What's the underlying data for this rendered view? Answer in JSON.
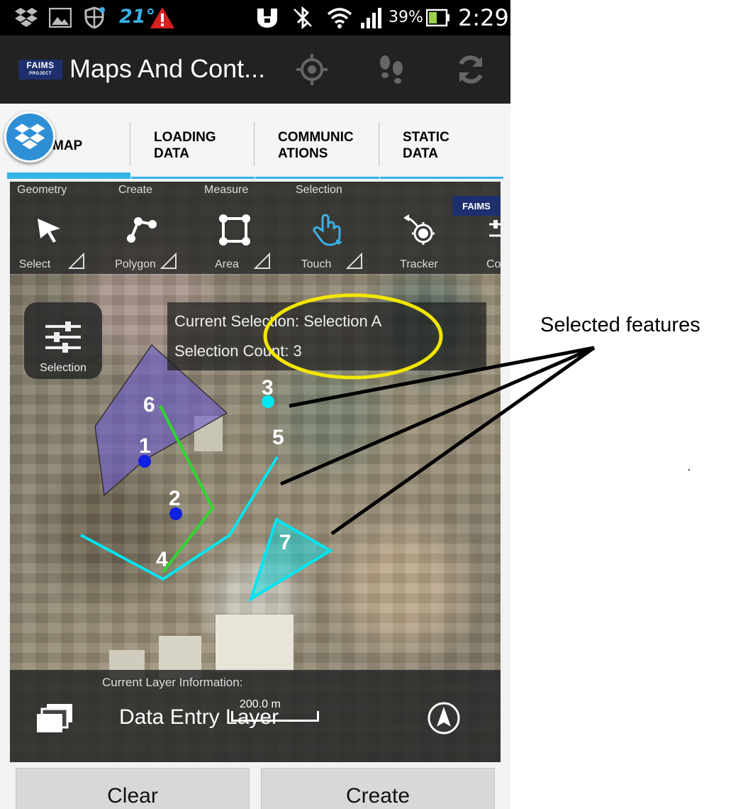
{
  "status_bar": {
    "temperature": "21°",
    "battery_percent": "39%",
    "time": "2:29",
    "icons": [
      "dropbox-icon",
      "image-icon",
      "shield-icon",
      "temperature-icon",
      "warning-icon",
      "nfc-icon",
      "bluetooth-icon",
      "wifi-icon",
      "signal-icon",
      "battery-icon"
    ]
  },
  "action_bar": {
    "logo_text": "FAIMS",
    "logo_subtext": "PROJECT",
    "title": "Maps And Cont...",
    "buttons": [
      "gps-icon",
      "footsteps-icon",
      "sync-icon"
    ]
  },
  "tabs": [
    {
      "label": "MAP",
      "active": true
    },
    {
      "label": "LOADING\nDATA",
      "active": false
    },
    {
      "label": "COMMUNIC\nATIONS",
      "active": false
    },
    {
      "label": "STATIC\nDATA",
      "active": false
    }
  ],
  "map": {
    "toolbar": {
      "groups": [
        "Geometry",
        "Create",
        "Measure",
        "Selection"
      ],
      "tools": [
        {
          "label": "Select",
          "icon": "arrow-icon"
        },
        {
          "label": "Polygon",
          "icon": "polygon-icon"
        },
        {
          "label": "Area",
          "icon": "area-icon"
        },
        {
          "label": "Touch",
          "icon": "touch-icon"
        },
        {
          "label": "Tracker",
          "icon": "tracker-icon"
        },
        {
          "label": "Co",
          "icon": "controls-icon"
        }
      ],
      "logo_text": "FAIMS"
    },
    "selection_button_label": "Selection",
    "selection_info": {
      "current_selection": "Current Selection: Selection A",
      "selection_count": "Selection Count: 3"
    },
    "feature_labels": [
      "1",
      "2",
      "3",
      "4",
      "5",
      "6",
      "7"
    ],
    "layer_info": {
      "caption": "Current Layer Information:",
      "layer_name": "Data Entry Layer",
      "scale": "200.0 m"
    },
    "colors": {
      "selected": "#00e5f0",
      "point": "#1020e0",
      "polygon": "#6a5acd",
      "line": "#2fd62f",
      "highlight_ellipse": "#f2e600"
    }
  },
  "buttons": {
    "clear": "Clear",
    "create": "Create"
  },
  "annotation": {
    "text": "Selected features"
  }
}
